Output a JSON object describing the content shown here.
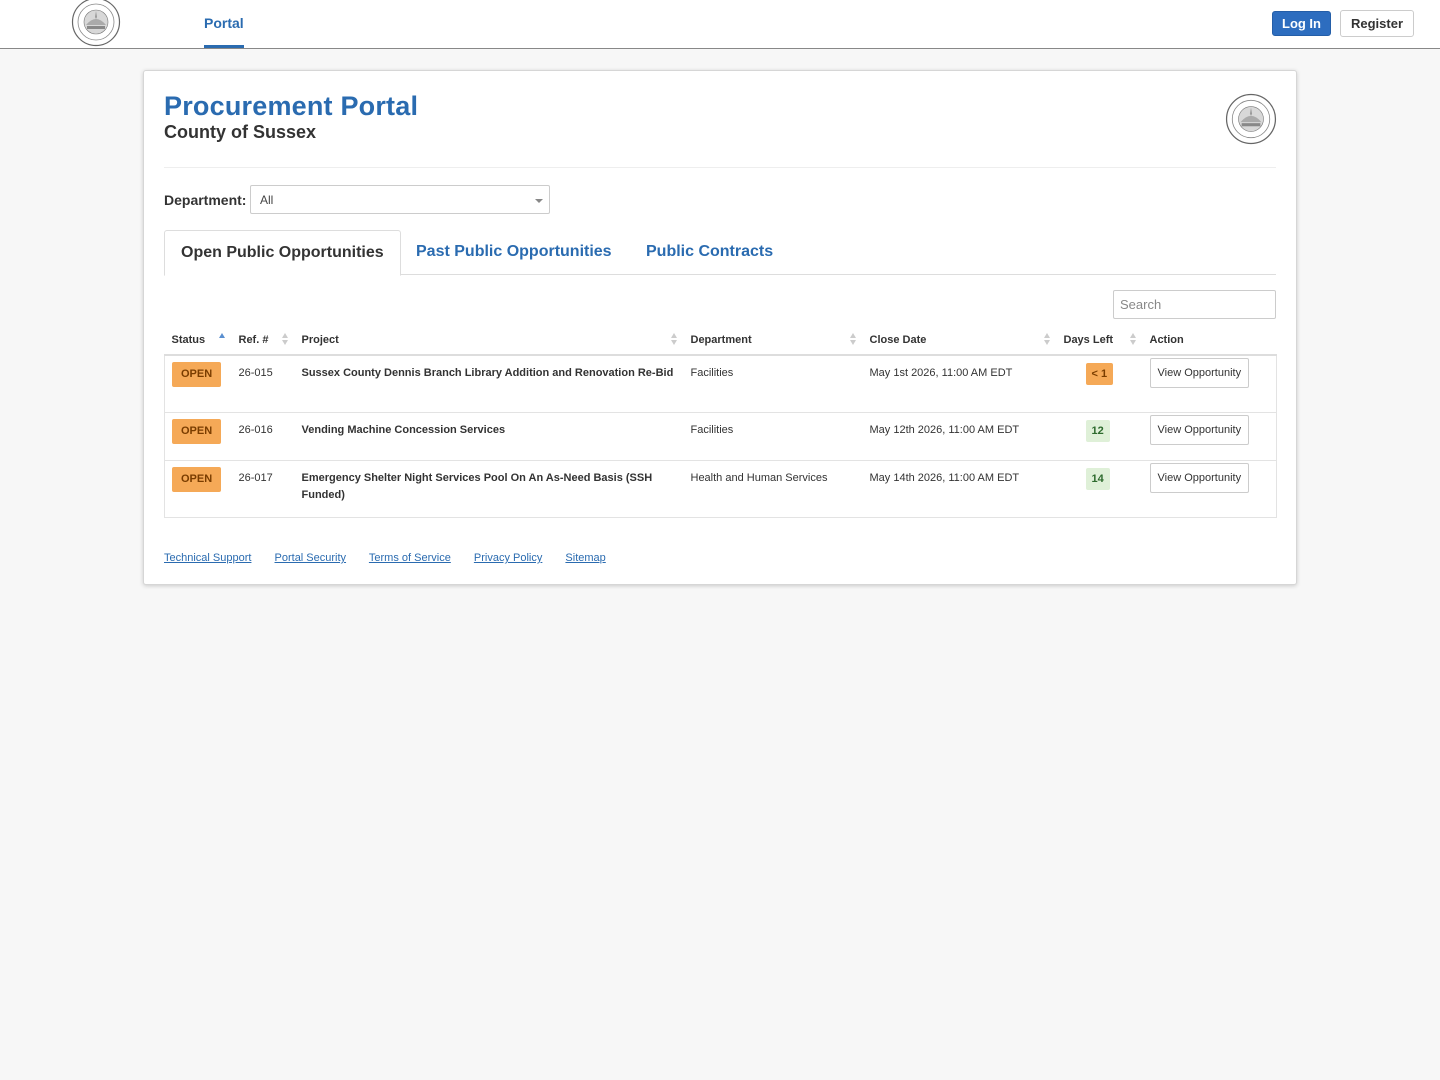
{
  "nav": {
    "seal_icon": "county-seal-icon",
    "portal_tab": "Portal",
    "login_label": "Log In",
    "register_label": "Register"
  },
  "header": {
    "title": "Procurement Portal",
    "subtitle": "County of Sussex"
  },
  "filter": {
    "department_label": "Department:",
    "department_value": "All"
  },
  "tabs": [
    {
      "label": "Open Public Opportunities",
      "active": true
    },
    {
      "label": "Past Public Opportunities",
      "active": false
    },
    {
      "label": "Public Contracts",
      "active": false
    }
  ],
  "search": {
    "placeholder": "Search"
  },
  "table": {
    "columns": [
      "Status",
      "Ref. #",
      "Project",
      "Department",
      "Close Date",
      "Days Left",
      "Action"
    ],
    "rows": [
      {
        "status": "OPEN",
        "ref": "26-015",
        "project": "Sussex County Dennis Branch Library Addition and Renovation Re-Bid",
        "department": "Facilities",
        "close_date": "May 1st 2026, 11:00 AM EDT",
        "days_left": "< 1",
        "days_color": "orange",
        "action": "View Opportunity"
      },
      {
        "status": "OPEN",
        "ref": "26-016",
        "project": "Vending Machine Concession Services",
        "department": "Facilities",
        "close_date": "May 12th 2026, 11:00 AM EDT",
        "days_left": "12",
        "days_color": "green",
        "action": "View Opportunity"
      },
      {
        "status": "OPEN",
        "ref": "26-017",
        "project": "Emergency Shelter Night Services Pool On An As-Need Basis (SSH Funded)",
        "department": "Health and Human Services",
        "close_date": "May 14th 2026, 11:00 AM EDT",
        "days_left": "14",
        "days_color": "green",
        "action": "View Opportunity"
      }
    ]
  },
  "footer": {
    "links": [
      "Technical Support",
      "Portal Security",
      "Terms of Service",
      "Privacy Policy",
      "Sitemap"
    ]
  },
  "colors": {
    "brand_blue": "#2a6bb0",
    "open_badge": "#f5a957",
    "days_green": "#dff0d8"
  }
}
